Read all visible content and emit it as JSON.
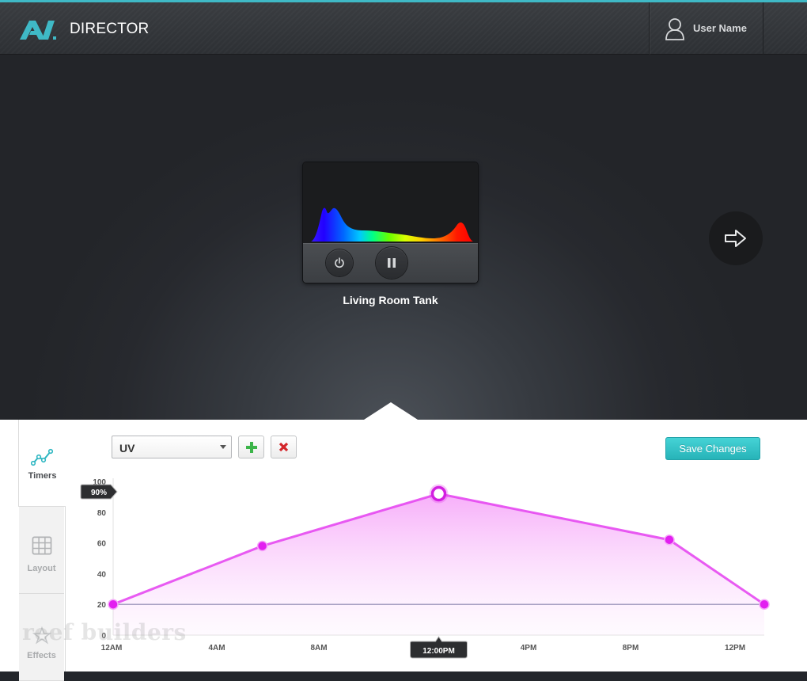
{
  "header": {
    "app_title": "DIRECTOR",
    "user_name": "User Name",
    "accent_color": "#3fb9c6"
  },
  "stage": {
    "fixture_name": "Living Room Tank",
    "buttons": [
      "power-icon",
      "pause-icon",
      "arrow-right-icon"
    ]
  },
  "sidebar": {
    "tabs": [
      {
        "label": "Timers",
        "icon": "timers-icon",
        "active": true
      },
      {
        "label": "Layout",
        "icon": "grid-icon",
        "active": false
      },
      {
        "label": "Effects",
        "icon": "effects-icon",
        "active": false
      }
    ]
  },
  "toolbar": {
    "channel_value": "UV",
    "save_label": "Save Changes"
  },
  "chart_data": {
    "type": "area",
    "series": [
      {
        "color": "#e43ff0",
        "x": [
          "12:00AM",
          "5:30AM",
          "12:00PM",
          "8:30PM",
          "12:00AM"
        ],
        "x_hours": [
          0,
          5.5,
          12,
          20.5,
          24
        ],
        "values": [
          20,
          58,
          92,
          62,
          20
        ]
      }
    ],
    "x_ticks": [
      "12AM",
      "4AM",
      "8AM",
      "4PM",
      "8PM",
      "12PM"
    ],
    "x_tick_hours": [
      0,
      4,
      8,
      16,
      20,
      24
    ],
    "y_ticks": [
      "0",
      "20",
      "40",
      "60",
      "80",
      "100"
    ],
    "ylim": [
      0,
      100
    ],
    "xlim": [
      0,
      24
    ],
    "baseline_value": 20,
    "selected_value_label": "90%",
    "selected_time_label": "12:00PM",
    "selected_index": 2
  },
  "watermark": "reef builders"
}
